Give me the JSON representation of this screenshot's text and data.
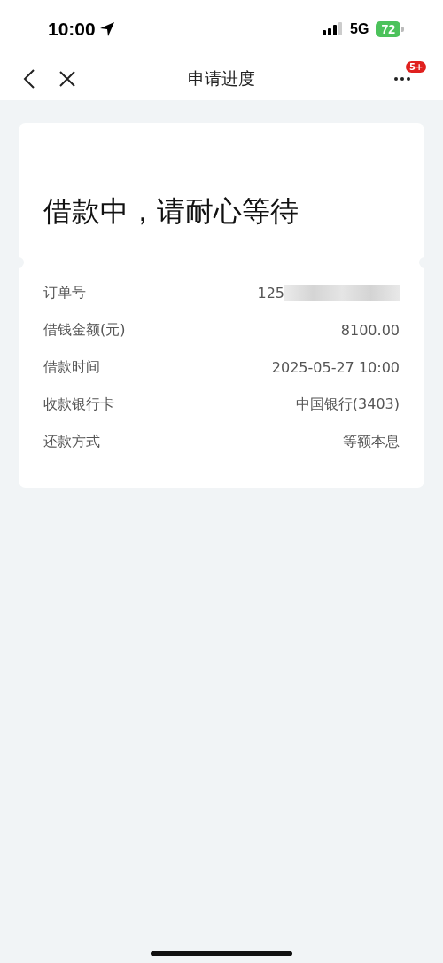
{
  "status_bar": {
    "time": "10:00",
    "network": "5G",
    "battery": "72"
  },
  "nav": {
    "title": "申请进度",
    "badge": "5+"
  },
  "card": {
    "title": "借款中，请耐心等待",
    "rows": [
      {
        "label": "订单号",
        "value": "125",
        "kind": "redacted"
      },
      {
        "label": "借钱金额(元)",
        "value": "8100.00",
        "kind": "plain"
      },
      {
        "label": "借款时间",
        "value": "2025-05-27 10:00",
        "kind": "plain"
      },
      {
        "label": "收款银行卡",
        "value": "中国银行(3403)",
        "kind": "plain"
      },
      {
        "label": "还款方式",
        "value": "等额本息",
        "kind": "plain"
      }
    ]
  }
}
